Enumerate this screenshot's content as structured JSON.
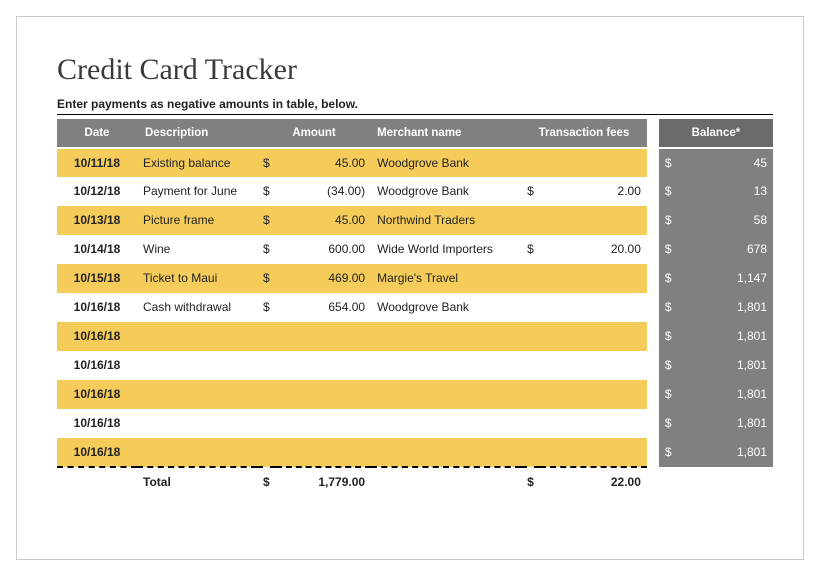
{
  "title": "Credit Card Tracker",
  "subtitle": "Enter payments as negative amounts in table, below.",
  "headers": {
    "date": "Date",
    "description": "Description",
    "amount": "Amount",
    "merchant": "Merchant name",
    "fees": "Transaction fees",
    "balance": "Balance*"
  },
  "rows": [
    {
      "date": "10/11/18",
      "desc": "Existing balance",
      "amount": "45.00",
      "merchant": "Woodgrove Bank",
      "fee_cur": "",
      "fee": "",
      "balance": "45"
    },
    {
      "date": "10/12/18",
      "desc": "Payment for June",
      "amount": "(34.00)",
      "merchant": "Woodgrove Bank",
      "fee_cur": "$",
      "fee": "2.00",
      "balance": "13"
    },
    {
      "date": "10/13/18",
      "desc": "Picture frame",
      "amount": "45.00",
      "merchant": "Northwind Traders",
      "fee_cur": "",
      "fee": "",
      "balance": "58"
    },
    {
      "date": "10/14/18",
      "desc": "Wine",
      "amount": "600.00",
      "merchant": "Wide World Importers",
      "fee_cur": "$",
      "fee": "20.00",
      "balance": "678"
    },
    {
      "date": "10/15/18",
      "desc": "Ticket to Maui",
      "amount": "469.00",
      "merchant": "Margie's Travel",
      "fee_cur": "",
      "fee": "",
      "balance": "1,147"
    },
    {
      "date": "10/16/18",
      "desc": "Cash withdrawal",
      "amount": "654.00",
      "merchant": "Woodgrove Bank",
      "fee_cur": "",
      "fee": "",
      "balance": "1,801"
    },
    {
      "date": "10/16/18",
      "desc": "",
      "amount": "",
      "merchant": "",
      "fee_cur": "",
      "fee": "",
      "balance": "1,801"
    },
    {
      "date": "10/16/18",
      "desc": "",
      "amount": "",
      "merchant": "",
      "fee_cur": "",
      "fee": "",
      "balance": "1,801"
    },
    {
      "date": "10/16/18",
      "desc": "",
      "amount": "",
      "merchant": "",
      "fee_cur": "",
      "fee": "",
      "balance": "1,801"
    },
    {
      "date": "10/16/18",
      "desc": "",
      "amount": "",
      "merchant": "",
      "fee_cur": "",
      "fee": "",
      "balance": "1,801"
    },
    {
      "date": "10/16/18",
      "desc": "",
      "amount": "",
      "merchant": "",
      "fee_cur": "",
      "fee": "",
      "balance": "1,801"
    }
  ],
  "totals": {
    "label": "Total",
    "amount_cur": "$",
    "amount": "1,779.00",
    "fee_cur": "$",
    "fee": "22.00"
  },
  "currency": "$"
}
